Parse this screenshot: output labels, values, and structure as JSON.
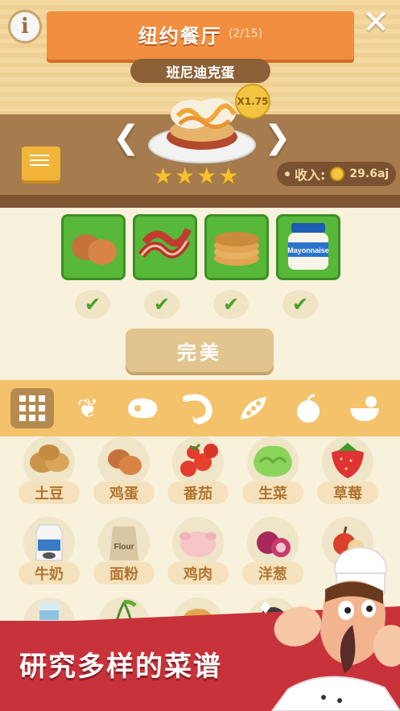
{
  "header": {
    "title": "纽约餐厅",
    "progress": "(2/15)",
    "dish_name": "班尼迪克蛋",
    "multiplier": "X1.75",
    "stars": 4,
    "income_label": "收入:",
    "income_value": "29.6aj"
  },
  "ingredients": [
    {
      "name": "egg-card"
    },
    {
      "name": "bacon-card"
    },
    {
      "name": "pancake-card"
    },
    {
      "name": "mayonnaise-card",
      "label": "Mayonnaise"
    }
  ],
  "action": {
    "label": "完美"
  },
  "tabs": [
    "grid-icon",
    "wheat-icon",
    "meat-icon",
    "shrimp-icon",
    "pea-icon",
    "apple-icon",
    "salad-bowl-icon"
  ],
  "pantry": {
    "row1": [
      "土豆",
      "鸡蛋",
      "番茄",
      "生菜",
      "草莓"
    ],
    "row2": [
      "牛奶",
      "面粉",
      "鸡肉",
      "洋葱"
    ]
  },
  "pantry_labels": {
    "milk_pack": "Flour"
  },
  "banner": {
    "text": "研究多样的菜谱"
  },
  "colors": {
    "accent": "#f28e3f",
    "green": "#57b839",
    "banner": "#c8323a"
  }
}
